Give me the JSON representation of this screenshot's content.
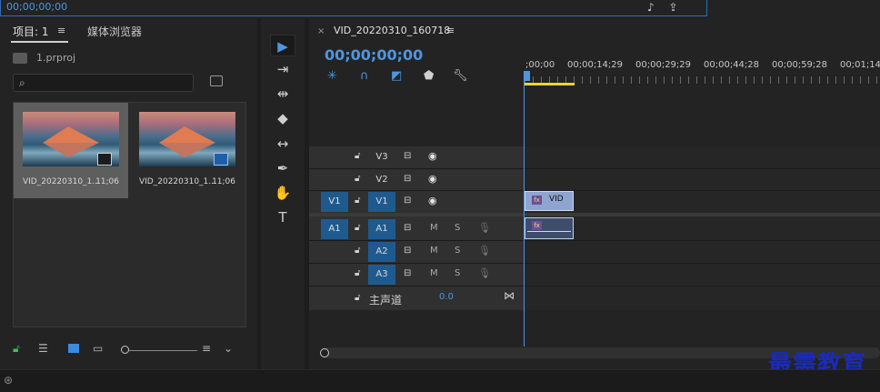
{
  "program_monitor": {
    "timecode": "00;00;00;00",
    "icons": [
      "export-frame-icon",
      "share-icon"
    ]
  },
  "project_panel": {
    "tab_project": "项目: 1",
    "tab_menu": "≡",
    "tab_media_browser": "媒体浏览器",
    "project_file": "1.prproj",
    "search_placeholder": "",
    "clips": [
      {
        "name": "VID_20220310_1...",
        "duration": "11;06",
        "badge": "audio-video-icon"
      },
      {
        "name": "VID_20220310_1...",
        "duration": "11;06",
        "badge": "sequence-icon"
      }
    ]
  },
  "tools": [
    "selection-tool",
    "track-select-tool",
    "ripple-edit-tool",
    "razor-tool",
    "slip-tool",
    "pen-tool",
    "hand-tool",
    "type-tool"
  ],
  "timeline": {
    "sequence_name": "VID_20220310_160718",
    "close": "×",
    "menu": "≡",
    "timecode": "00;00;00;00",
    "ruler_labels": [
      ";00;00",
      "00;00;14;29",
      "00;00;29;29",
      "00;00;44;28",
      "00;00;59;28",
      "00;01;14;"
    ],
    "video_tracks": [
      {
        "source": "",
        "name": "V3"
      },
      {
        "source": "",
        "name": "V2"
      },
      {
        "source": "V1",
        "name": "V1"
      }
    ],
    "audio_tracks": [
      {
        "source": "A1",
        "name": "A1"
      },
      {
        "source": "",
        "name": "A2"
      },
      {
        "source": "",
        "name": "A3"
      }
    ],
    "mute_label": "M",
    "solo_label": "S",
    "master_label": "主声道",
    "master_value": "0.0",
    "video_clip_label": "VID",
    "fx_label": "fx"
  },
  "watermark": "最需教育",
  "colors": {
    "accent": "#4f95e0",
    "track_on": "#1f5a8f",
    "work_area": "#e8d62f",
    "lock_green": "#37c456"
  }
}
